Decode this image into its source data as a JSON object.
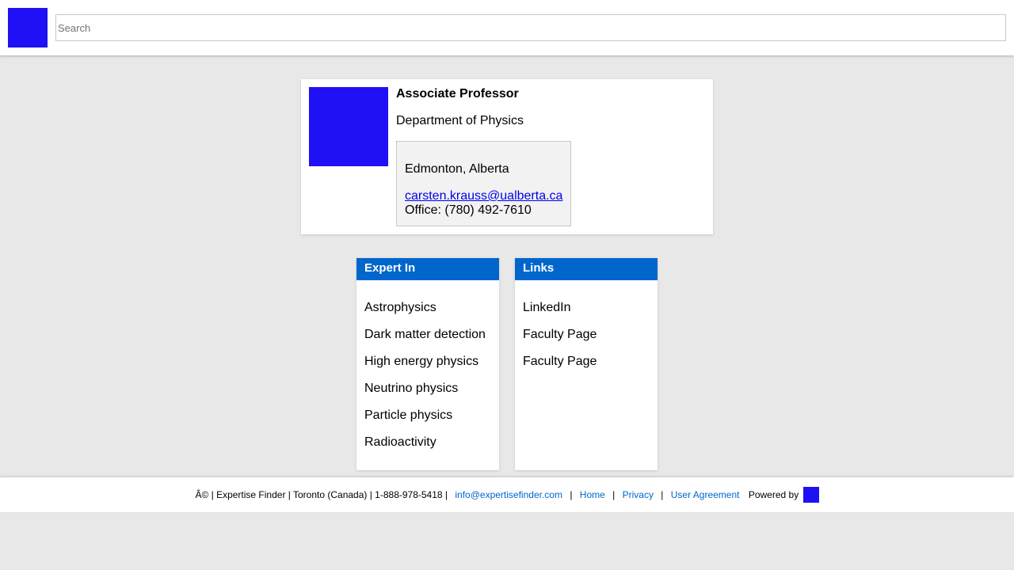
{
  "header": {
    "search_placeholder": "Search"
  },
  "profile": {
    "title": "Associate Professor",
    "department": "Department of Physics",
    "location": "Edmonton, Alberta",
    "email": "carsten.krauss@ualberta.ca",
    "office": "Office: (780) 492-7610"
  },
  "expert": {
    "heading": "Expert In",
    "items": [
      "Astrophysics",
      "Dark matter detection",
      "High energy physics",
      "Neutrino physics",
      "Particle physics",
      "Radioactivity"
    ]
  },
  "links": {
    "heading": "Links",
    "items": [
      "LinkedIn",
      "Faculty Page",
      "Faculty Page"
    ]
  },
  "footer": {
    "copyright": "Â© | Expertise Finder | Toronto (Canada) | 1-888-978-5418 |",
    "email_link": "info@expertisefinder.com",
    "sep": "|",
    "home": "Home",
    "privacy": "Privacy",
    "user_agreement": "User Agreement",
    "powered_by": "Powered by"
  },
  "colors": {
    "accent_blue": "#0066cc",
    "logo_blue": "#1f10f5",
    "background": "#e8e8e8"
  }
}
